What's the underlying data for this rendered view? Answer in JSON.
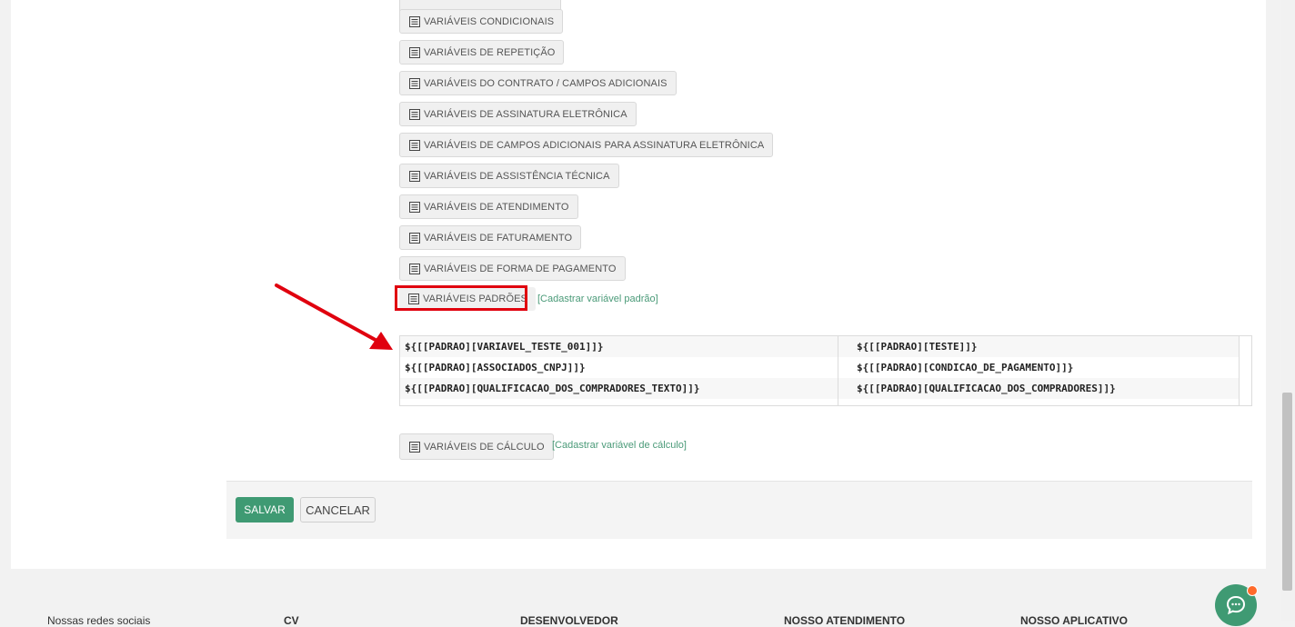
{
  "variable_buttons": [
    {
      "label": "VARIÁVEIS CONDICIONAIS"
    },
    {
      "label": "VARIÁVEIS DE REPETIÇÃO"
    },
    {
      "label": "VARIÁVEIS DO CONTRATO / CAMPOS ADICIONAIS"
    },
    {
      "label": "VARIÁVEIS DE ASSINATURA ELETRÔNICA"
    },
    {
      "label": "VARIÁVEIS DE CAMPOS ADICIONAIS PARA ASSINATURA ELETRÔNICA"
    },
    {
      "label": "VARIÁVEIS DE ASSISTÊNCIA TÉCNICA"
    },
    {
      "label": "VARIÁVEIS DE ATENDIMENTO"
    },
    {
      "label": "VARIÁVEIS DE FATURAMENTO"
    },
    {
      "label": "VARIÁVEIS DE FORMA DE PAGAMENTO"
    }
  ],
  "padroes": {
    "label": "VARIÁVEIS PADRÕES",
    "register_link": "[Cadastrar variável padrão]",
    "table": [
      [
        "${[[PADRAO][VARIAVEL_TESTE_001]]}",
        "${[[PADRAO][TESTE]]}"
      ],
      [
        "${[[PADRAO][ASSOCIADOS_CNPJ]]}",
        "${[[PADRAO][CONDICAO_DE_PAGAMENTO]]}"
      ],
      [
        "${[[PADRAO][QUALIFICACAO_DOS_COMPRADORES_TEXTO]]}",
        "${[[PADRAO][QUALIFICACAO_DOS_COMPRADORES]]}"
      ]
    ]
  },
  "calculo": {
    "label": "VARIÁVEIS DE CÁLCULO",
    "register_link": "[Cadastrar variável de cálculo]"
  },
  "actions": {
    "save_label": "SALVAR",
    "cancel_label": "CANCELAR"
  },
  "footer_sections": [
    "Nossas redes sociais",
    "CV",
    "DESENVOLVEDOR",
    "NOSSO ATENDIMENTO",
    "NOSSO APLICATIVO"
  ],
  "colors": {
    "accent": "#3f9a73",
    "highlight": "#e0000e",
    "notification": "#ff6a2b"
  },
  "icons": {
    "variable_button": "list-icon",
    "chat": "chat-bubble-icon",
    "annotation": "red-arrow"
  }
}
